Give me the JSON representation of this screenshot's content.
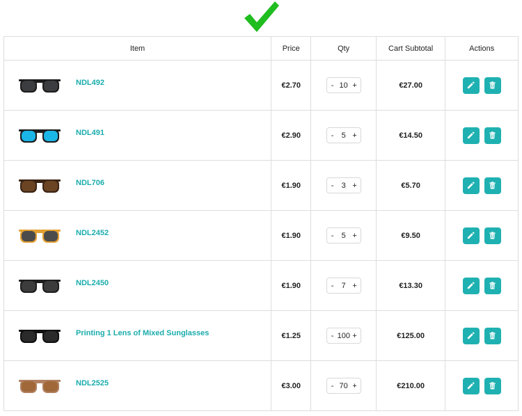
{
  "status": {
    "icon": "check-icon",
    "color": "#1fbd1f"
  },
  "table": {
    "headers": {
      "item": "Item",
      "price": "Price",
      "qty": "Qty",
      "subtotal": "Cart Subtotal",
      "actions": "Actions"
    },
    "rows": [
      {
        "name": "NDL492",
        "price": "€2.70",
        "qty": "10",
        "subtotal": "€27.00",
        "frame_color": "#1c1c1c",
        "lens_color": "#3c3d40"
      },
      {
        "name": "NDL491",
        "price": "€2.90",
        "qty": "5",
        "subtotal": "€14.50",
        "frame_color": "#1c1c1c",
        "lens_color": "#1ab6e8"
      },
      {
        "name": "NDL706",
        "price": "€1.90",
        "qty": "3",
        "subtotal": "€5.70",
        "frame_color": "#3b2414",
        "lens_color": "#6b4424"
      },
      {
        "name": "NDL2452",
        "price": "€1.90",
        "qty": "5",
        "subtotal": "€9.50",
        "frame_color": "#e3a032",
        "lens_color": "#4b4b4b"
      },
      {
        "name": "NDL2450",
        "price": "€1.90",
        "qty": "7",
        "subtotal": "€13.30",
        "frame_color": "#1e1e1e",
        "lens_color": "#3c3c3c"
      },
      {
        "name": "Printing 1 Lens of Mixed Sunglasses",
        "price": "€1.25",
        "qty": "100",
        "subtotal": "€125.00",
        "frame_color": "#111111",
        "lens_color": "#2a2a2a"
      },
      {
        "name": "NDL2525",
        "price": "€3.00",
        "qty": "70",
        "subtotal": "€210.00",
        "frame_color": "#b08060",
        "lens_color": "#a06838"
      }
    ],
    "minus_label": "-",
    "plus_label": "+",
    "edit_icon": "pencil-icon",
    "delete_icon": "trash-icon",
    "action_color": "#1fb1b1",
    "link_color": "#1aacac"
  }
}
